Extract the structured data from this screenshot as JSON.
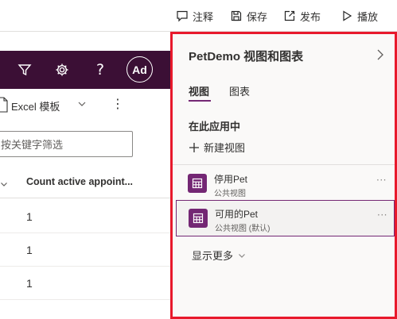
{
  "commandbar": {
    "comments_label": "注释",
    "save_label": "保存",
    "publish_label": "发布",
    "play_label": "播放"
  },
  "appbar": {
    "help_glyph": "?",
    "avatar_initials": "Ad",
    "icons": [
      "filter-icon",
      "gear-icon",
      "help-icon"
    ]
  },
  "grid": {
    "excel_templates_label": "Excel 模板",
    "more_glyph": "⋮",
    "filter_placeholder": "按关键字筛选",
    "column_header": "Count active appoint...",
    "rows": [
      "1",
      "1",
      "1"
    ]
  },
  "panel": {
    "title": "PetDemo 视图和图表",
    "tabs": [
      "视图",
      "图表"
    ],
    "active_tab": "视图",
    "section_title": "在此应用中",
    "new_view_label": "新建视图",
    "views": [
      {
        "name": "停用Pet",
        "subtitle": "公共视图",
        "more": "···"
      },
      {
        "name": "可用的Pet",
        "subtitle": "公共视图 (默认)",
        "more": "···"
      }
    ],
    "show_more_label": "显示更多"
  },
  "colors": {
    "app_header": "#3b0f35",
    "accent": "#742774",
    "highlight_border": "#e8192c"
  }
}
